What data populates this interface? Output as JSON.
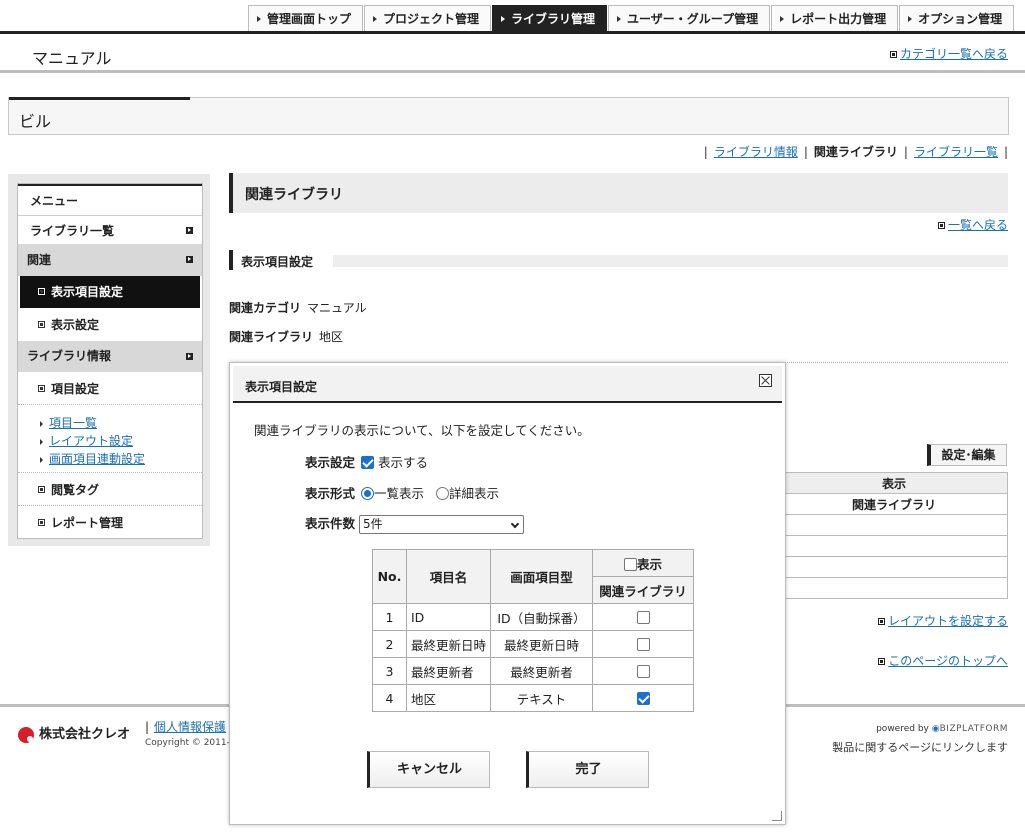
{
  "topnav": [
    "管理画面トップ",
    "プロジェクト管理",
    "ライブラリ管理",
    "ユーザー・グループ管理",
    "レポート出力管理",
    "オプション管理"
  ],
  "active_tab": "ライブラリ管理",
  "page_title": "マニュアル",
  "back_category": "カテゴリ一覧へ戻る",
  "library_name": "ビル",
  "sublinks": {
    "info": "ライブラリ情報",
    "related": "関連ライブラリ",
    "list": "ライブラリ一覧"
  },
  "sidebar": {
    "menu": "メニュー",
    "library_list": "ライブラリ一覧",
    "related": "関連",
    "display_item_setting": "表示項目設定",
    "display_setting": "表示設定",
    "library_info": "ライブラリ情報",
    "item_setting": "項目設定",
    "links": [
      "項目一覧",
      "レイアウト設定",
      "画面項目連動設定"
    ],
    "browse_tag": "閲覧タグ",
    "report_mgmt": "レポート管理"
  },
  "main": {
    "heading": "関連ライブラリ",
    "back_list": "一覧へ戻る",
    "section": "表示項目設定",
    "related_category_label": "関連カテゴリ",
    "related_category_value": "マニュアル",
    "related_library_label": "関連ライブラリ",
    "related_library_value": "地区",
    "set_edit": "設定･編集",
    "table_header1": "表示",
    "table_header2": "関連ライブラリ",
    "layout_link": "レイアウトを設定する",
    "page_top": "このページのトップへ"
  },
  "footer": {
    "company": "株式会社クレオ",
    "privacy": "個人情報保護",
    "copyright": "Copyright © 2011-",
    "powered": "powered by",
    "platform": "BIZPLATFORM",
    "product_link": "製品に関するページにリンクします"
  },
  "modal": {
    "title": "表示項目設定",
    "intro": "関連ライブラリの表示について、以下を設定してください。",
    "display_setting_label": "表示設定",
    "display_checkbox": "表示する",
    "display_format_label": "表示形式",
    "format_options": [
      "一覧表示",
      "詳細表示"
    ],
    "selected_format": "一覧表示",
    "count_label": "表示件数",
    "count_value": "5件",
    "table": {
      "col_no": "No.",
      "col_name": "項目名",
      "col_type": "画面項目型",
      "col_show": "表示",
      "col_related": "関連ライブラリ",
      "rows": [
        {
          "no": "1",
          "name": "ID",
          "type": "ID（自動採番）",
          "checked": false
        },
        {
          "no": "2",
          "name": "最終更新日時",
          "type": "最終更新日時",
          "checked": false
        },
        {
          "no": "3",
          "name": "最終更新者",
          "type": "最終更新者",
          "checked": false
        },
        {
          "no": "4",
          "name": "地区",
          "type": "テキスト",
          "checked": true
        }
      ]
    },
    "cancel": "キャンセル",
    "done": "完了"
  }
}
